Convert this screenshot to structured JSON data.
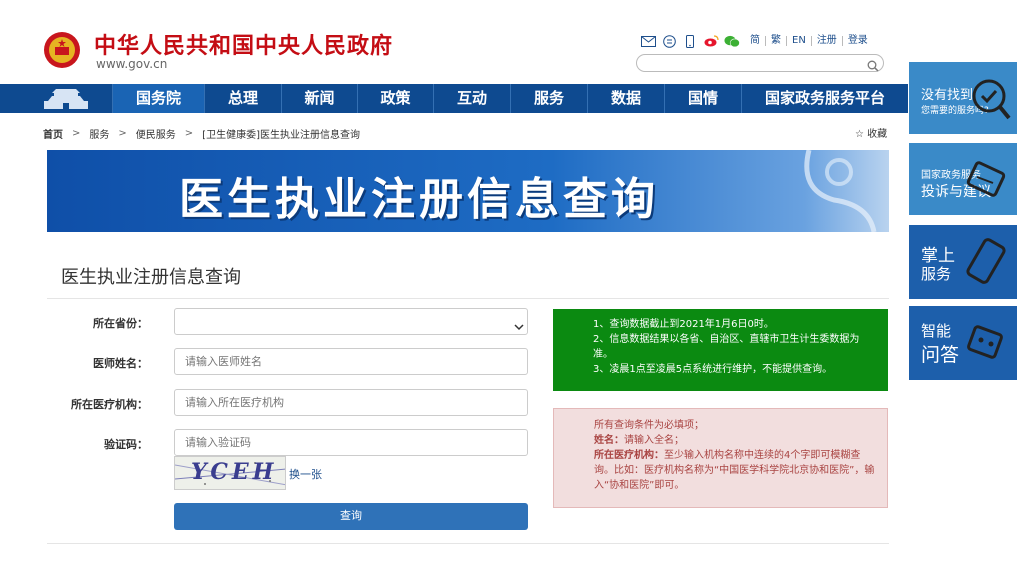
{
  "header": {
    "site_title": "中华人民共和国中央人民政府",
    "site_url": "www.gov.cn",
    "toplinks": [
      "简",
      "繁",
      "EN",
      "注册",
      "登录"
    ],
    "share_icons": [
      "mail-icon",
      "message-icon",
      "mobile-icon",
      "weibo-icon",
      "wechat-icon"
    ],
    "search_placeholder": ""
  },
  "nav": {
    "items": [
      "国务院",
      "总理",
      "新闻",
      "政策",
      "互动",
      "服务",
      "数据",
      "国情",
      "国家政务服务平台"
    ],
    "active": "国务院"
  },
  "breadcrumb": {
    "items": [
      "首页",
      "服务",
      "便民服务",
      "[卫生健康委]医生执业注册信息查询"
    ],
    "favorite": "收藏"
  },
  "banner": {
    "title": "医生执业注册信息查询"
  },
  "form": {
    "section_title": "医生执业注册信息查询",
    "province_label": "所在省份：",
    "province_value": "",
    "name_label": "医师姓名：",
    "name_placeholder": "请输入医师姓名",
    "org_label": "所在医疗机构：",
    "org_placeholder": "请输入所在医疗机构",
    "captcha_label": "验证码：",
    "captcha_placeholder": "请输入验证码",
    "captcha_text": "YCEH",
    "change_link": "换一张",
    "submit": "查询"
  },
  "notice_green": {
    "line1": "1、查询数据截止到2021年1月6日0时。",
    "line2": "2、信息数据结果以各省、自治区、直辖市卫生计生委数据为准。",
    "line3": "3、凌晨1点至凌晨5点系统进行维护，不能提供查询。"
  },
  "notice_red": {
    "intro": "所有查询条件为必填项；",
    "name_key": "姓名：",
    "name_val": "请输入全名；",
    "org_key": "所在医疗机构：",
    "org_val": "至少输入机构名称中连续的4个字即可模糊查询。比如：医疗机构名称为“中国医学科学院北京协和医院”，输入“协和医院”即可。"
  },
  "side": {
    "tile1_l1": "没有找到",
    "tile1_l2": "您需要的服务吗?",
    "tile2_l1": "国家政务服务",
    "tile2_l2": "投诉与建议",
    "tile3_l1": "掌上",
    "tile3_l2": "服务",
    "tile4_l1": "智能",
    "tile4_l2": "问答"
  },
  "colors": {
    "brand_red": "#c40d14",
    "nav_blue": "#0e4a90",
    "notice_green": "#0b8a11",
    "notice_red_bg": "#f2dede",
    "button_blue": "#2f72b8"
  }
}
